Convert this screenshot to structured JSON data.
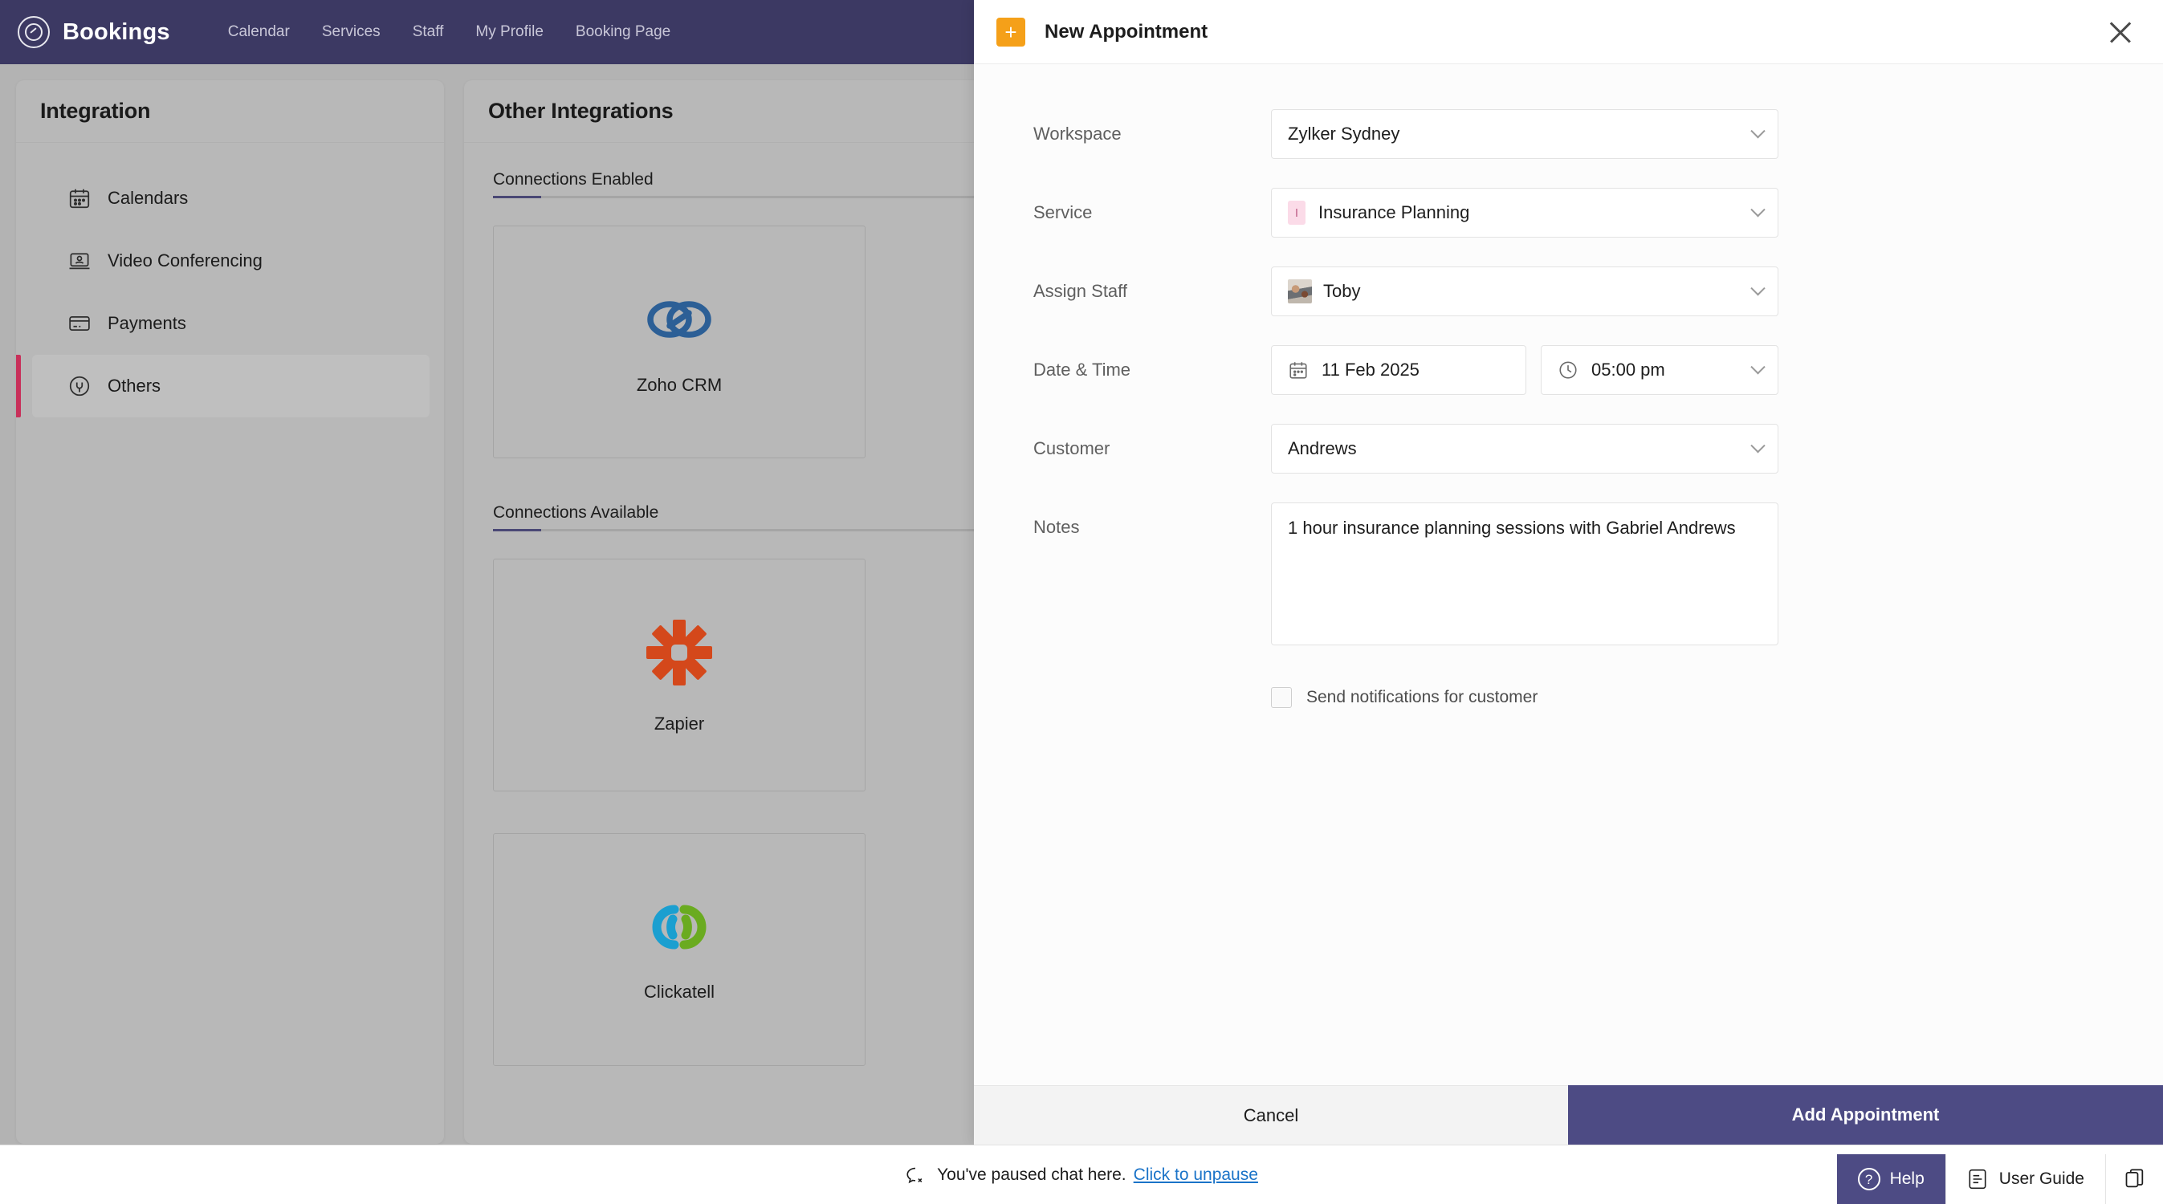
{
  "topnav": {
    "brand": "Bookings",
    "links": [
      "Calendar",
      "Services",
      "Staff",
      "My Profile",
      "Booking Page"
    ]
  },
  "integration_panel": {
    "title": "Integration",
    "items": [
      {
        "label": "Calendars",
        "icon": "calendar-icon",
        "active": false
      },
      {
        "label": "Video Conferencing",
        "icon": "video-icon",
        "active": false
      },
      {
        "label": "Payments",
        "icon": "credit-card-icon",
        "active": false
      },
      {
        "label": "Others",
        "icon": "plug-icon",
        "active": true
      }
    ]
  },
  "other_integrations": {
    "title": "Other Integrations",
    "sections": [
      {
        "heading": "Connections Enabled",
        "tiles": [
          {
            "name": "Zoho CRM",
            "icon": "zoho-crm-logo"
          }
        ]
      },
      {
        "heading": "Connections Available",
        "tiles": [
          {
            "name": "Zapier",
            "icon": "zapier-logo"
          },
          {
            "name": "Clickatell",
            "icon": "clickatell-logo"
          }
        ]
      }
    ]
  },
  "modal": {
    "title": "New Appointment",
    "add_icon": "plus-icon",
    "close_icon": "close-icon",
    "fields": {
      "workspace": {
        "label": "Workspace",
        "value": "Zylker Sydney"
      },
      "service": {
        "label": "Service",
        "value": "Insurance Planning",
        "badge_letter": "I"
      },
      "staff": {
        "label": "Assign Staff",
        "value": "Toby"
      },
      "datetime": {
        "label": "Date & Time",
        "date": "11 Feb 2025",
        "time": "05:00 pm"
      },
      "customer": {
        "label": "Customer",
        "value": "Andrews"
      },
      "notes": {
        "label": "Notes",
        "value": "1 hour insurance planning sessions with Gabriel Andrews"
      },
      "notify": {
        "label": "Send notifications for customer",
        "checked": false
      }
    },
    "footer": {
      "cancel": "Cancel",
      "submit": "Add Appointment"
    }
  },
  "chatbar": {
    "message": "You've paused chat here.",
    "link": "Click to unpause"
  },
  "helpbar": {
    "help": "Help",
    "user_guide": "User Guide"
  },
  "colors": {
    "nav_purple": "#3c3963",
    "primary_purple": "#4d4b84",
    "accent_pink": "#c8305a",
    "orange_badge": "#f5a019",
    "link_blue": "#1a73c8"
  }
}
